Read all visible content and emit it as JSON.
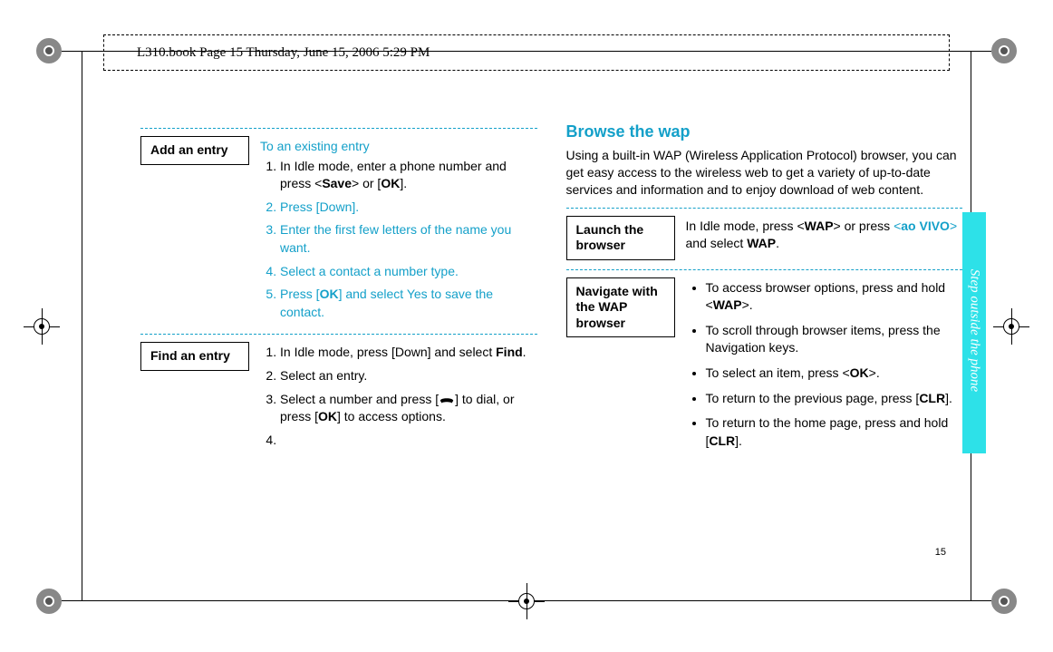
{
  "header": "L310.book  Page 15  Thursday, June 15, 2006  5:29 PM",
  "page_number": "15",
  "side_tab": "Step outside the phone",
  "left": {
    "add_entry": {
      "label": "Add an entry",
      "subhead": "To an existing entry",
      "step1a": "In Idle mode, enter a phone number and press <",
      "step1_save": "Save",
      "step1b": "> or [",
      "step1_ok": "OK",
      "step1c": "].",
      "step2": "Press [Down].",
      "step3": "Enter the first few letters of the name you want.",
      "step4": "Select a contact  a number type.",
      "step5a": "Press [",
      "step5_ok": "OK",
      "step5b": "] and select Yes to save the contact."
    },
    "find_entry": {
      "label": "Find an entry",
      "step1a": "In Idle mode, press [Down] and select ",
      "step1_find": "Find",
      "step1b": ".",
      "step2": "Select an entry.",
      "step3a": "Select a number and press [",
      "step3b": "] to dial, or press [",
      "step3_ok": "OK",
      "step3c": "] to access options.",
      "step4": ""
    }
  },
  "right": {
    "heading": "Browse the wap",
    "intro": "Using a built-in WAP (Wireless Application Protocol) browser, you can get easy access to the wireless web to get a variety of up-to-date services and information and to enjoy download of web content.",
    "launch": {
      "label": "Launch the browser",
      "text_a": "In Idle mode, press <",
      "wap": "WAP",
      "text_b": "> or press ",
      "ao_open": "<",
      "ao": "ao VIVO",
      "ao_close": ">",
      "text_c": " and select ",
      "wap2": "WAP",
      "text_d": "."
    },
    "nav": {
      "label": "Navigate with the WAP browser",
      "b1a": "To access browser options, press and hold <",
      "b1_wap": "WAP",
      "b1b": ">.",
      "b2": "To scroll through browser items, press the Navigation keys.",
      "b3a": "To select an item, press <",
      "b3_ok": "OK",
      "b3b": ">.",
      "b4a": "To return to the previous page, press [",
      "b4_clr": "CLR",
      "b4b": "].",
      "b5a": "To return to the home page, press and hold [",
      "b5_clr": "CLR",
      "b5b": "]."
    }
  }
}
